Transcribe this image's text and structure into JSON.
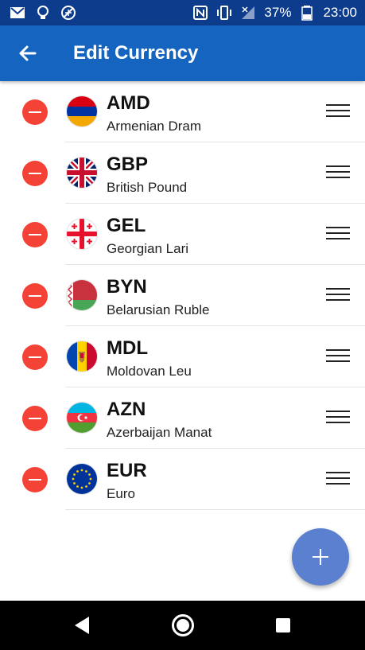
{
  "status_bar": {
    "battery_percent": "37%",
    "time": "23:00"
  },
  "app_bar": {
    "title": "Edit Currency"
  },
  "currencies": [
    {
      "code": "AMD",
      "name": "Armenian Dram",
      "flag_icon": "armenia-flag-icon"
    },
    {
      "code": "GBP",
      "name": "British Pound",
      "flag_icon": "uk-flag-icon"
    },
    {
      "code": "GEL",
      "name": "Georgian Lari",
      "flag_icon": "georgia-flag-icon"
    },
    {
      "code": "BYN",
      "name": "Belarusian Ruble",
      "flag_icon": "belarus-flag-icon"
    },
    {
      "code": "MDL",
      "name": "Moldovan Leu",
      "flag_icon": "moldova-flag-icon"
    },
    {
      "code": "AZN",
      "name": "Azerbaijan Manat",
      "flag_icon": "azerbaijan-flag-icon"
    },
    {
      "code": "EUR",
      "name": "Euro",
      "flag_icon": "eu-flag-icon"
    }
  ],
  "colors": {
    "status_bar": "#0d3c8c",
    "app_bar": "#1565c0",
    "remove_button": "#f44336",
    "fab": "#5b80d0"
  }
}
